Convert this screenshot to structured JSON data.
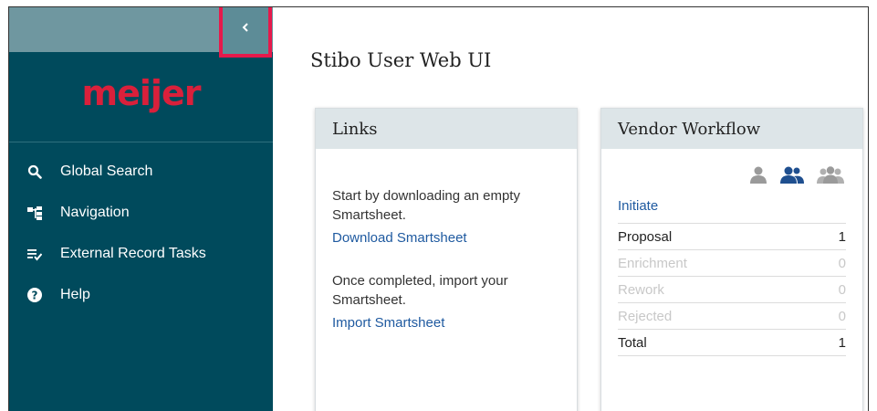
{
  "sidebar": {
    "logo_text": "meijer",
    "items": [
      {
        "label": "Global Search",
        "icon": "search-icon"
      },
      {
        "label": "Navigation",
        "icon": "hierarchy-icon"
      },
      {
        "label": "External Record Tasks",
        "icon": "task-list-icon"
      },
      {
        "label": "Help",
        "icon": "help-icon"
      }
    ]
  },
  "colors": {
    "sidebar_bg": "#004a5c",
    "sidebar_top_bg": "#6f97a0",
    "logo": "#d9203b",
    "highlight_border": "#e6194b",
    "link": "#1f5aa0",
    "card_header_bg": "#dde5e8"
  },
  "main": {
    "title": "Stibo User Web UI",
    "links_card": {
      "title": "Links",
      "text1": "Start by downloading an empty Smartsheet.",
      "link1": "Download Smartsheet",
      "text2": "Once completed, import your Smartsheet.",
      "link2": "Import Smartsheet"
    },
    "workflow_card": {
      "title": "Vendor Workflow",
      "icons": [
        "user-icon",
        "users-icon",
        "group-icon"
      ],
      "initiate": "Initiate",
      "rows": [
        {
          "label": "Proposal",
          "count": "1"
        },
        {
          "label": "Enrichment",
          "count": "0"
        },
        {
          "label": "Rework",
          "count": "0"
        },
        {
          "label": "Rejected",
          "count": "0"
        },
        {
          "label": "Total",
          "count": "1"
        }
      ]
    }
  }
}
